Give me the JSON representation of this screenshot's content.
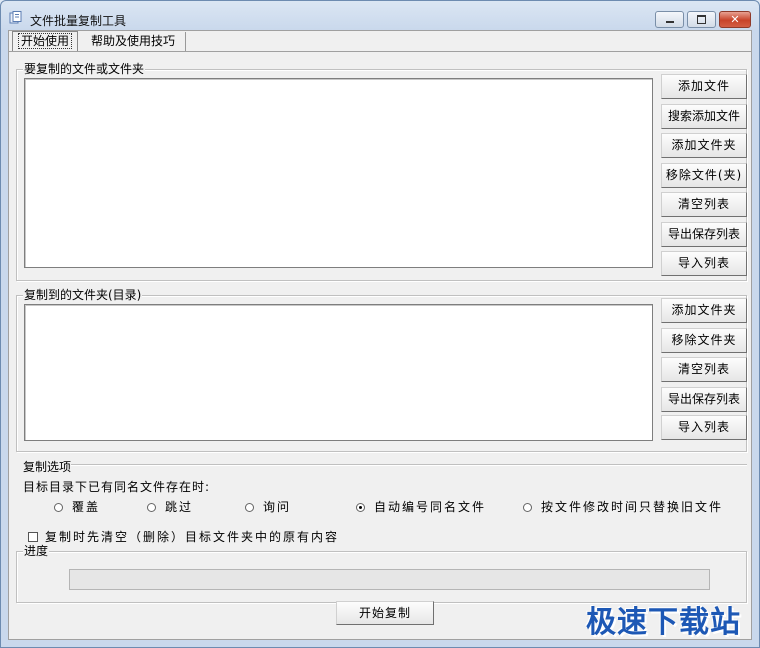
{
  "window": {
    "title": "文件批量复制工具",
    "minimize_glyph": "—",
    "maximize_glyph": "□",
    "close_glyph": "✕"
  },
  "tabs": [
    {
      "label": "开始使用",
      "active": true
    },
    {
      "label": "帮助及使用技巧",
      "active": false
    }
  ],
  "source_group": {
    "legend": "要复制的文件或文件夹",
    "buttons": [
      "添加文件",
      "搜索添加文件",
      "添加文件夹",
      "移除文件(夹)",
      "清空列表",
      "导出保存列表",
      "导入列表"
    ]
  },
  "dest_group": {
    "legend": "复制到的文件夹(目录)",
    "buttons": [
      "添加文件夹",
      "移除文件夹",
      "清空列表",
      "导出保存列表",
      "导入列表"
    ]
  },
  "options": {
    "legend": "复制选项",
    "prompt": "目标目录下已有同名文件存在时:",
    "radios": [
      {
        "label": "覆盖",
        "checked": false
      },
      {
        "label": "跳过",
        "checked": false
      },
      {
        "label": "询问",
        "checked": false
      },
      {
        "label": "自动编号同名文件",
        "checked": true
      },
      {
        "label": "按文件修改时间只替换旧文件",
        "checked": false
      }
    ],
    "clear_checkbox": {
      "label": "复制时先清空（删除）目标文件夹中的原有内容",
      "checked": false
    }
  },
  "progress": {
    "legend": "进度",
    "value": 0
  },
  "start_button": "开始复制",
  "watermark": "极速下载站",
  "colors": {
    "title_bg": "#c9d8ec",
    "close_red": "#c8432a",
    "watermark_blue": "#1d58b5"
  }
}
